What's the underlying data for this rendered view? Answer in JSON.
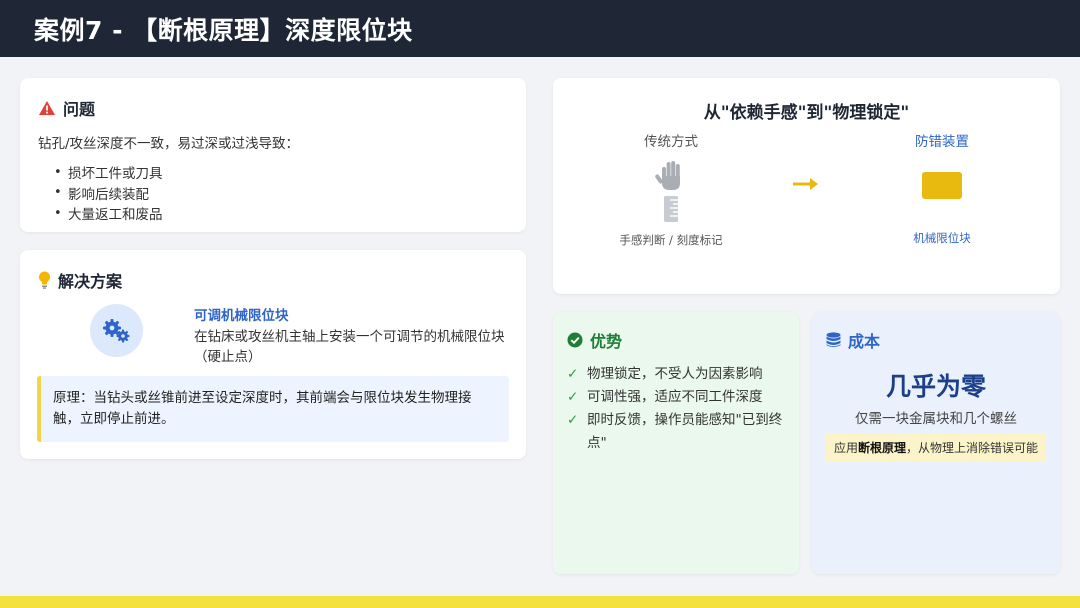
{
  "header": {
    "title": "案例7 - 【断根原理】深度限位块"
  },
  "problem": {
    "title": "问题",
    "description": "钻孔/攻丝深度不一致，易过深或过浅导致：",
    "bullet": "•",
    "items": [
      "损坏工件或刀具",
      "影响后续装配",
      "大量返工和废品"
    ]
  },
  "solution": {
    "title": "解决方案",
    "item_title": "可调机械限位块",
    "item_desc": "在钻床或攻丝机主轴上安装一个可调节的机械限位块（硬止点）",
    "principle": "原理：当钻头或丝锥前进至设定深度时，其前端会与限位块发生物理接触，立即停止前进。"
  },
  "transform": {
    "title": "从\"依赖手感\"到\"物理锁定\"",
    "left_label": "传统方式",
    "left_caption": "手感判断 / 刻度标记",
    "arrow": "→",
    "right_label": "防错装置",
    "right_caption": "机械限位块"
  },
  "advantages": {
    "title": "优势",
    "check": "✓",
    "items": [
      "物理锁定，不受人为因素影响",
      "可调性强，适应不同工件深度",
      "即时反馈，操作员能感知\"已到终点\""
    ]
  },
  "cost": {
    "title": "成本",
    "headline": "几乎为零",
    "sub": "仅需一块金属块和几个螺丝",
    "note_prefix": "应用",
    "note_bold": "断根原理",
    "note_suffix": "，从物理上消除错误可能"
  },
  "colors": {
    "header_bg": "#1f2736",
    "accent_yellow": "#f5e13c",
    "problem_red": "#e0403a",
    "solution_blue": "#2f65c8",
    "advantage_green": "#1e7e35",
    "block_gold": "#e8b90f"
  },
  "icons": {
    "problem": "warning-triangle-icon",
    "solution": "lightbulb-icon",
    "gears": "gears-icon",
    "hand": "hand-icon",
    "ruler": "ruler-icon",
    "arrow": "arrow-right-icon",
    "block": "metal-block-icon",
    "advantages": "check-circle-icon",
    "cost": "coins-icon"
  }
}
